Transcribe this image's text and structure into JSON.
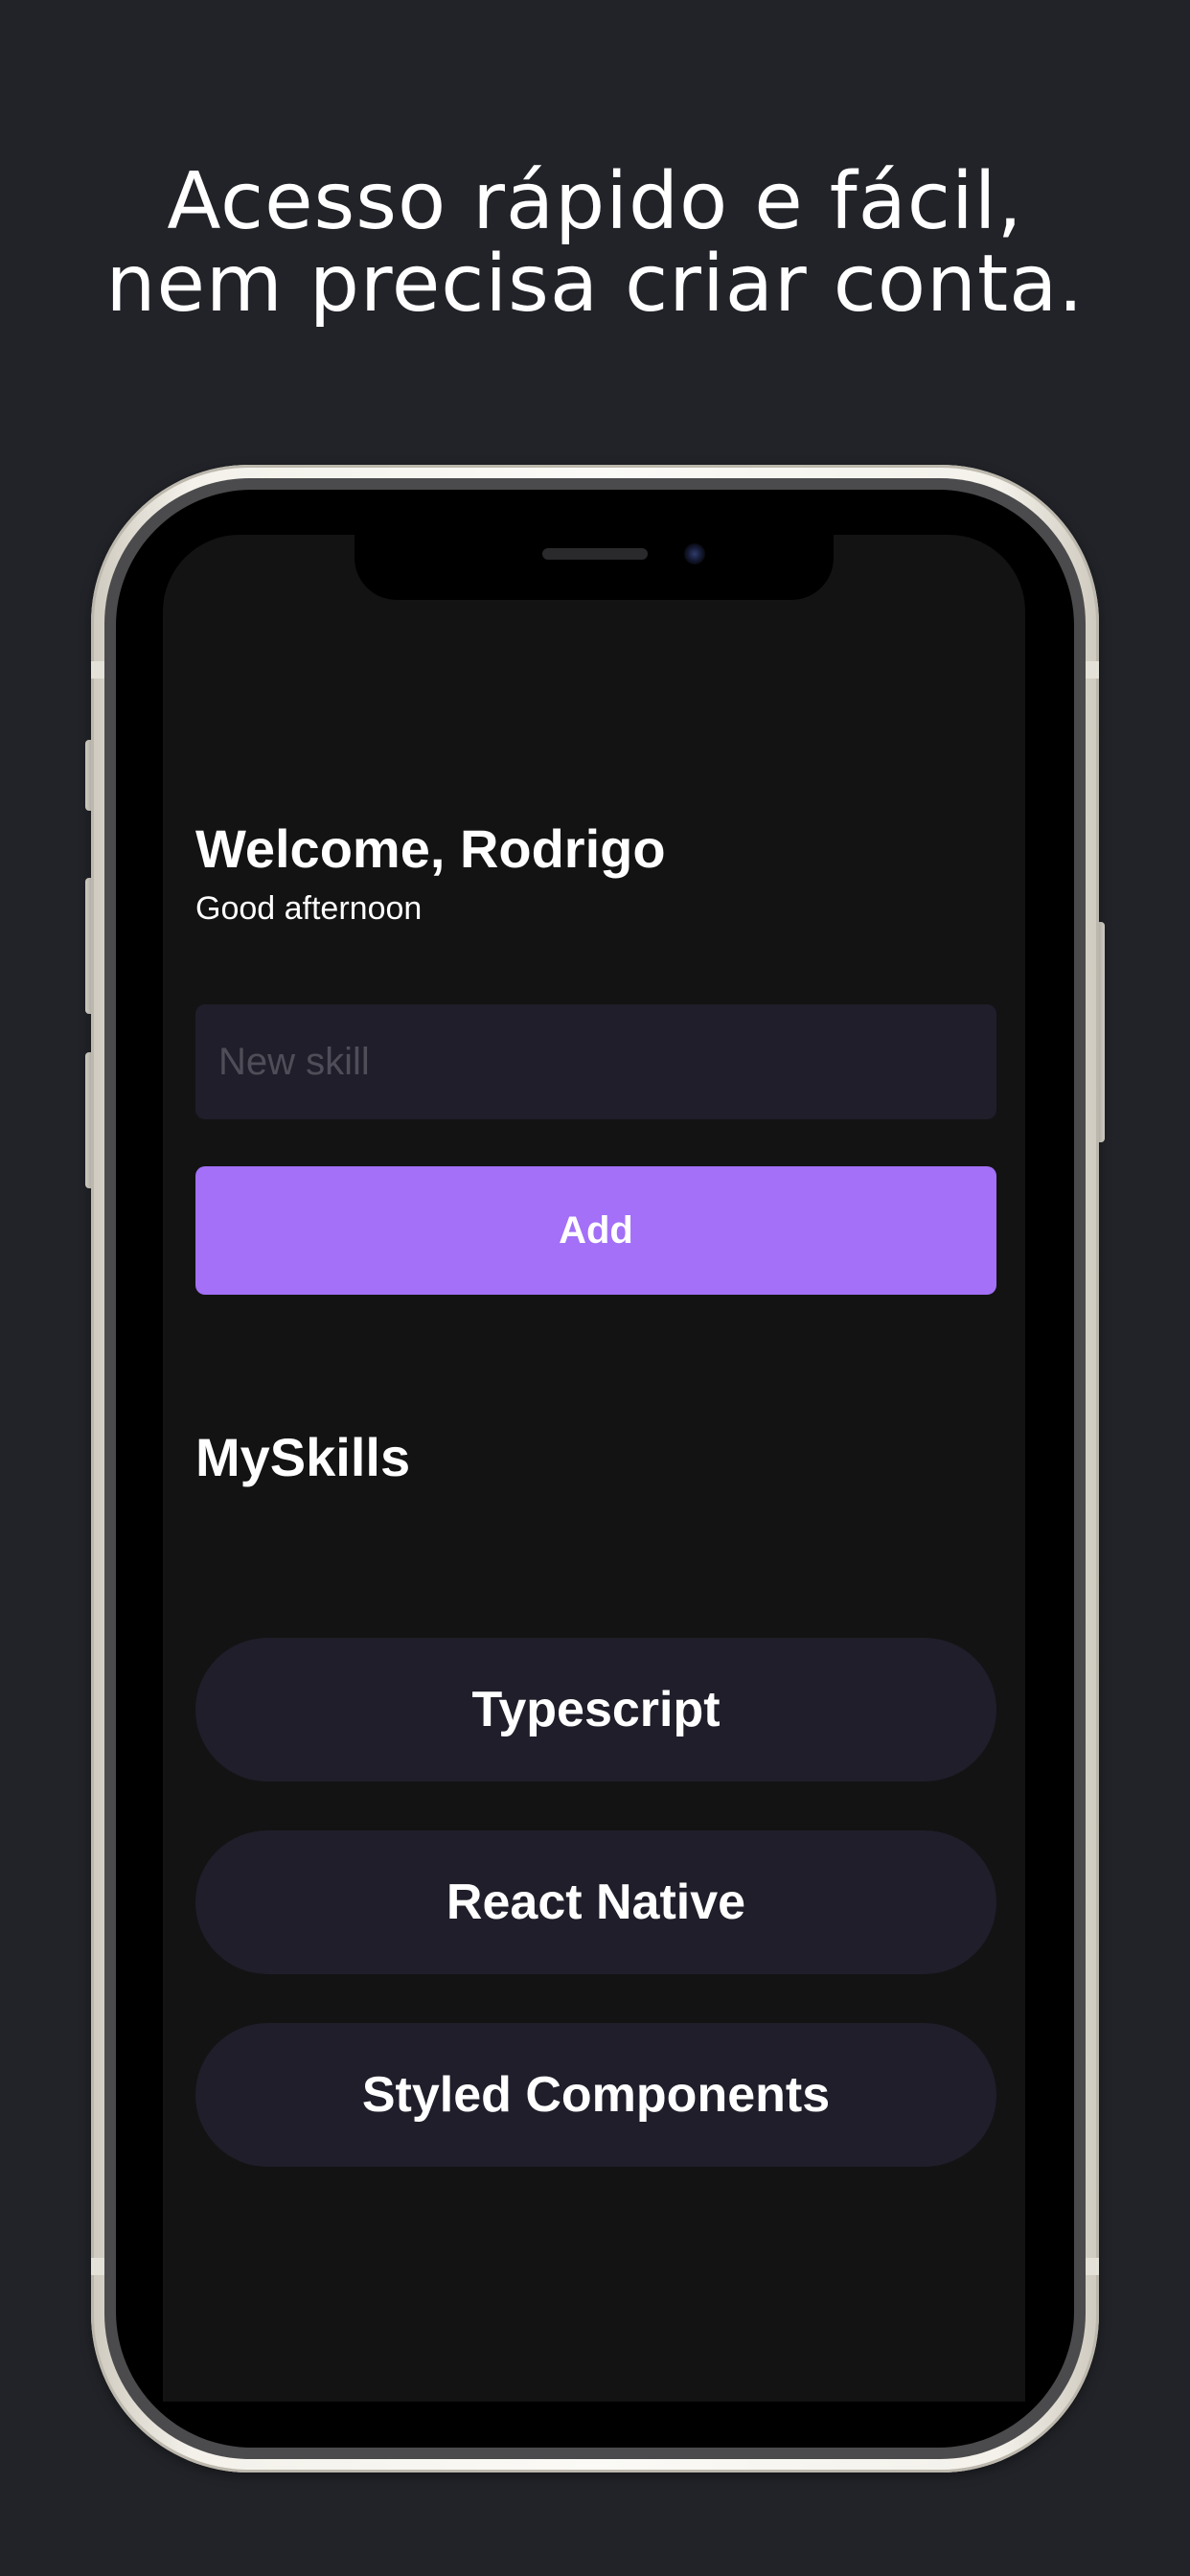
{
  "promo": {
    "headline_line1": "Acesso rápido e fácil,",
    "headline_line2": "nem precisa criar conta."
  },
  "app": {
    "welcome_title": "Welcome, Rodrigo",
    "greeting": "Good afternoon",
    "skill_input": {
      "placeholder": "New skill",
      "value": ""
    },
    "add_button_label": "Add",
    "section_title": "MySkills",
    "skills": [
      {
        "name": "Typescript"
      },
      {
        "name": "React Native"
      },
      {
        "name": "Styled Components"
      }
    ]
  },
  "colors": {
    "page_background": "#212328",
    "screen_background": "#131314",
    "input_background": "#1f1e2a",
    "accent": "#a370f7",
    "text": "#ffffff"
  }
}
